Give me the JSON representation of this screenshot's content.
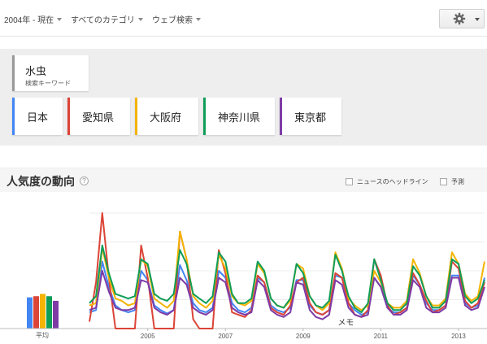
{
  "filters": {
    "time": "2004年 - 現在",
    "category": "すべてのカテゴリ",
    "search_type": "ウェブ検索"
  },
  "keyword": {
    "term": "水虫",
    "sublabel": "検索キーワード"
  },
  "regions": [
    {
      "name": "日本",
      "color": "#4285f4"
    },
    {
      "name": "愛知県",
      "color": "#db4437"
    },
    {
      "name": "大阪府",
      "color": "#f4b400"
    },
    {
      "name": "神奈川県",
      "color": "#0f9d58"
    },
    {
      "name": "東京都",
      "color": "#7e3ba6"
    }
  ],
  "section": {
    "title": "人気度の動向",
    "help": "?",
    "news_label": "ニュースのヘッドライン",
    "forecast_label": "予測"
  },
  "chart_data": {
    "type": "line",
    "x": [
      2004.0,
      2004.17,
      2004.33,
      2004.5,
      2004.67,
      2004.83,
      2005.0,
      2005.17,
      2005.33,
      2005.5,
      2005.67,
      2005.83,
      2006.0,
      2006.17,
      2006.33,
      2006.5,
      2006.67,
      2006.83,
      2007.0,
      2007.17,
      2007.33,
      2007.5,
      2007.67,
      2007.83,
      2008.0,
      2008.17,
      2008.33,
      2008.5,
      2008.67,
      2008.83,
      2009.0,
      2009.17,
      2009.33,
      2009.5,
      2009.67,
      2009.83,
      2010.0,
      2010.17,
      2010.33,
      2010.5,
      2010.67,
      2010.83,
      2011.0,
      2011.17,
      2011.33,
      2011.5,
      2011.67,
      2011.83,
      2012.0,
      2012.17,
      2012.33,
      2012.5,
      2012.67,
      2012.83,
      2013.0,
      2013.17,
      2013.33,
      2013.5,
      2013.67,
      2013.83,
      2014.0,
      2014.17
    ],
    "x_ticks": [
      "2005",
      "2007",
      "2009",
      "2011",
      "2013"
    ],
    "ylim": [
      0,
      100
    ],
    "annotation": "メモ",
    "average_label": "平均",
    "averages": [
      27,
      28,
      30,
      28,
      24
    ],
    "series": [
      {
        "name": "日本",
        "color": "#4285f4",
        "values": [
          14,
          16,
          58,
          36,
          20,
          16,
          14,
          16,
          50,
          42,
          20,
          16,
          13,
          16,
          55,
          42,
          22,
          16,
          14,
          18,
          50,
          44,
          22,
          16,
          14,
          18,
          44,
          40,
          20,
          16,
          14,
          18,
          42,
          42,
          20,
          14,
          12,
          16,
          46,
          44,
          22,
          16,
          12,
          14,
          44,
          36,
          18,
          14,
          14,
          18,
          46,
          38,
          22,
          16,
          16,
          20,
          46,
          46,
          22,
          18,
          20,
          44
        ]
      },
      {
        "name": "愛知県",
        "color": "#db4437",
        "values": [
          6,
          40,
          100,
          44,
          0,
          0,
          0,
          0,
          72,
          44,
          0,
          0,
          0,
          0,
          84,
          60,
          8,
          0,
          0,
          0,
          68,
          48,
          14,
          12,
          10,
          16,
          46,
          40,
          18,
          14,
          12,
          20,
          40,
          44,
          22,
          14,
          12,
          16,
          48,
          44,
          22,
          12,
          10,
          16,
          60,
          46,
          20,
          12,
          14,
          18,
          48,
          38,
          24,
          14,
          16,
          20,
          58,
          52,
          24,
          18,
          22,
          40
        ]
      },
      {
        "name": "大阪府",
        "color": "#f4b400",
        "values": [
          20,
          22,
          70,
          44,
          26,
          24,
          20,
          22,
          60,
          54,
          26,
          22,
          18,
          24,
          84,
          60,
          28,
          22,
          18,
          24,
          64,
          52,
          28,
          22,
          20,
          24,
          56,
          48,
          26,
          20,
          18,
          24,
          56,
          52,
          28,
          20,
          16,
          22,
          66,
          52,
          26,
          20,
          16,
          20,
          50,
          40,
          22,
          18,
          18,
          24,
          60,
          48,
          28,
          20,
          20,
          26,
          66,
          56,
          30,
          24,
          28,
          58
        ]
      },
      {
        "name": "神奈川県",
        "color": "#0f9d58",
        "values": [
          22,
          28,
          72,
          48,
          30,
          28,
          26,
          28,
          60,
          56,
          30,
          26,
          24,
          30,
          68,
          56,
          30,
          26,
          22,
          28,
          66,
          58,
          30,
          22,
          22,
          26,
          58,
          50,
          26,
          20,
          18,
          26,
          56,
          48,
          28,
          20,
          18,
          24,
          64,
          50,
          28,
          18,
          14,
          22,
          60,
          42,
          22,
          16,
          16,
          22,
          54,
          46,
          28,
          18,
          18,
          24,
          60,
          56,
          28,
          22,
          26,
          42
        ]
      },
      {
        "name": "東京都",
        "color": "#7e3ba6",
        "values": [
          16,
          18,
          50,
          32,
          18,
          16,
          16,
          18,
          42,
          40,
          18,
          14,
          12,
          16,
          44,
          38,
          18,
          14,
          12,
          16,
          44,
          40,
          18,
          14,
          12,
          14,
          42,
          36,
          16,
          12,
          10,
          14,
          40,
          38,
          16,
          10,
          8,
          12,
          42,
          38,
          18,
          12,
          10,
          12,
          44,
          36,
          18,
          12,
          12,
          16,
          42,
          36,
          18,
          14,
          14,
          18,
          44,
          44,
          20,
          16,
          18,
          36
        ]
      }
    ]
  }
}
